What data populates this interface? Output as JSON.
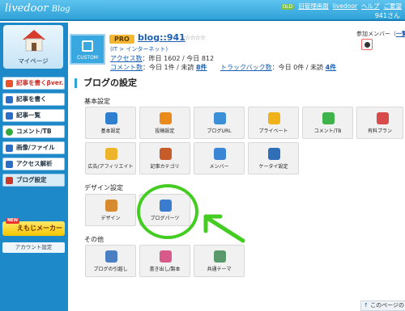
{
  "header": {
    "logo_text": "livedoor",
    "logo_sub": "Blog",
    "old_badge": "OLD",
    "links": [
      "旧管理画面",
      "livedoor",
      "ヘルプ",
      "ご要望"
    ],
    "user": "941さん"
  },
  "sidebar": {
    "mypage": "マイページ",
    "items": [
      {
        "label": "記事を書くβver.",
        "icon": "pencil-icon",
        "color": "#e8532b"
      },
      {
        "label": "記事を書く",
        "icon": "pencil-icon",
        "color": "#2b6ec8"
      },
      {
        "label": "記事一覧",
        "icon": "list-icon",
        "color": "#2b6ec8"
      },
      {
        "label": "コメント/TB",
        "icon": "comment-icon",
        "color": "#34a83a"
      },
      {
        "label": "画像/ファイル",
        "icon": "image-icon",
        "color": "#2b6ec8"
      },
      {
        "label": "アクセス解析",
        "icon": "chart-icon",
        "color": "#2b6ec8"
      },
      {
        "label": "ブログ設定",
        "icon": "wrench-icon",
        "color": "#c8382b"
      }
    ],
    "new_badge": "NEW",
    "emoji_maker": "えもじメーカー",
    "account_settings": "アカウント設定"
  },
  "blog": {
    "thumb_label": "CUSTOM",
    "pro": "PRO",
    "name": "blog::941",
    "stars": "☆☆☆☆☆",
    "category": "(IT > インターネット)",
    "access_label": "アクセス数",
    "access_value": "：昨日 1602 / 今日 812",
    "comment_label": "コメント数",
    "comment_value": "：今日 1件 / 未読 ",
    "comment_unread": "8件",
    "trackback_label": "トラックバック数",
    "trackback_value": "：今日 0件 / 未読 ",
    "trackback_unread": "4件"
  },
  "members": {
    "title": "参加メンバー（",
    "link": "一覧"
  },
  "page_title": "ブログの設定",
  "sections": [
    {
      "title": "基本設定",
      "tiles": [
        {
          "label": "基本設定",
          "icon": "id-card-icon",
          "color": "#2f7fd0"
        },
        {
          "label": "投稿設定",
          "icon": "pencil-icon",
          "color": "#e98a1b"
        },
        {
          "label": "ブログURL",
          "icon": "globe-icon",
          "color": "#3c8fd6"
        },
        {
          "label": "プライベート",
          "icon": "lock-icon",
          "color": "#f0b21a"
        },
        {
          "label": "コメント/TB",
          "icon": "speech-bubble-icon",
          "color": "#3fb34a"
        },
        {
          "label": "有料プラン",
          "icon": "card-icon",
          "color": "#d94b4b"
        },
        {
          "label": "広告/アフィリエイト",
          "icon": "coin-icon",
          "color": "#efb52a"
        },
        {
          "label": "記事カテゴリ",
          "icon": "folder-icon",
          "color": "#c75b2a"
        },
        {
          "label": "メンバー",
          "icon": "people-icon",
          "color": "#3a86d4"
        },
        {
          "label": "ケータイ設定",
          "icon": "phone-icon",
          "color": "#2f6fb8"
        }
      ]
    },
    {
      "title": "デザイン設定",
      "tiles": [
        {
          "label": "デザイン",
          "icon": "palette-icon",
          "color": "#d88a2f"
        },
        {
          "label": "ブログパーツ",
          "icon": "blocks-icon",
          "color": "#3a7ccf"
        }
      ]
    },
    {
      "title": "その他",
      "tiles": [
        {
          "label": "ブログの引越し",
          "icon": "truck-icon",
          "color": "#4a7fc4"
        },
        {
          "label": "書き出し/製本",
          "icon": "book-icon",
          "color": "#d85a8a"
        },
        {
          "label": "共通テーマ",
          "icon": "cloud-icon",
          "color": "#5a9a6a"
        }
      ]
    }
  ],
  "next_link": "このページの"
}
